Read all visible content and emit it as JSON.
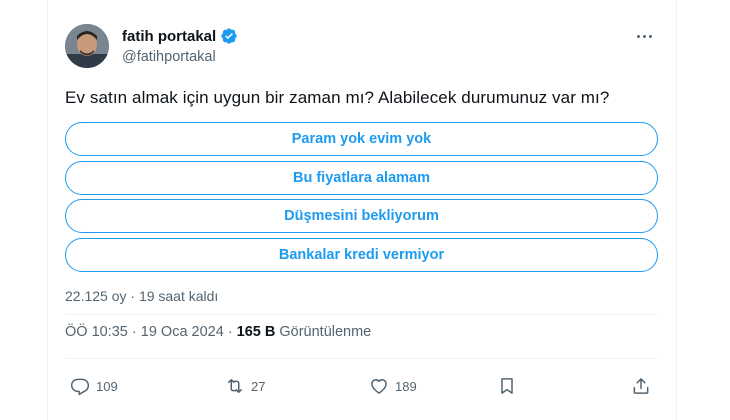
{
  "author": {
    "display_name": "fatih portakal",
    "handle": "@fatihportakal",
    "verified": true
  },
  "tweet": {
    "text": "Ev satın almak için uygun bir zaman mı? Alabilecek durumunuz var mı?"
  },
  "poll": {
    "options": [
      "Param yok evim yok",
      "Bu fiyatlara alamam",
      "Düşmesini bekliyorum",
      "Bankalar kredi vermiyor"
    ],
    "votes_and_time": "22.125 oy · 19 saat kaldı"
  },
  "meta": {
    "time_date": "ÖÖ 10:35 · 19 Oca 2024 ·",
    "views_count": "165 B",
    "views_label": "Görüntülenme"
  },
  "actions": {
    "reply_count": "109",
    "retweet_count": "27",
    "like_count": "189"
  },
  "colors": {
    "accent": "#1d9bf0",
    "text_primary": "#0f1419",
    "text_secondary": "#536471"
  },
  "icons": [
    "verified-badge-icon",
    "more-icon",
    "reply-icon",
    "retweet-icon",
    "like-icon",
    "bookmark-icon",
    "share-icon"
  ]
}
